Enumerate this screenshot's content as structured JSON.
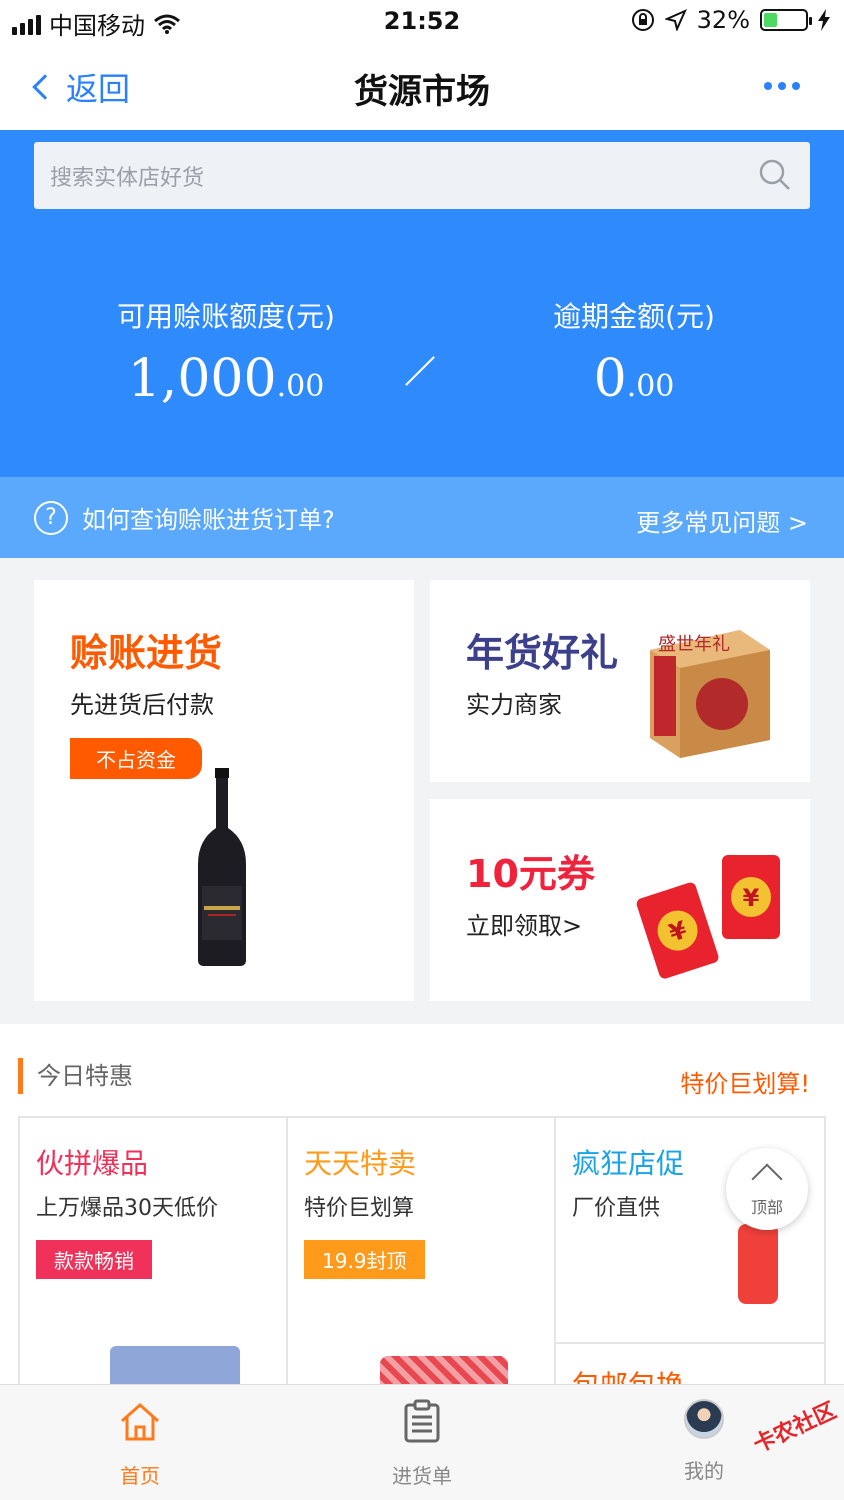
{
  "status_bar": {
    "carrier": "中国移动",
    "time": "21:52",
    "battery": "32%",
    "battery_level": 0.32
  },
  "nav": {
    "back_label": "返回",
    "title": "货源市场"
  },
  "search": {
    "placeholder": "搜索实体店好货"
  },
  "credit": {
    "available_label": "可用赊账额度(元)",
    "available_int": "1,000",
    "available_dec": ".00",
    "overdue_label": "逾期金额(元)",
    "overdue_int": "0",
    "overdue_dec": ".00"
  },
  "faq": {
    "question": "如何查询赊账进货订单?",
    "more": "更多常见问题 >"
  },
  "promos": {
    "credit_buy": {
      "title": "赊账进货",
      "subtitle": "先进货后付款",
      "badge": "不占资金"
    },
    "new_year": {
      "title": "年货好礼",
      "subtitle": "实力商家",
      "box_text": "盛世年礼"
    },
    "coupon": {
      "title": "10元券",
      "subtitle": "立即领取>"
    }
  },
  "today": {
    "heading": "今日特惠",
    "more": "特价巨划算!",
    "cells": [
      {
        "title": "伙拼爆品",
        "subtitle": "上万爆品30天低价",
        "tag": "款款畅销",
        "title_color": "#f0325a",
        "tag_color": "#f0325a"
      },
      {
        "title": "天天特卖",
        "subtitle": "特价巨划算",
        "tag": "19.9封顶",
        "title_color": "#ff9a1a",
        "tag_color": "#ff9a1a"
      },
      {
        "title": "疯狂店促",
        "subtitle": "厂价直供",
        "title_color": "#1aa3e8"
      },
      {
        "title": "包邮包换",
        "title_color": "#ff5a00"
      }
    ]
  },
  "back_to_top": "顶部",
  "tabbar": [
    {
      "label": "首页",
      "active": true
    },
    {
      "label": "进货单",
      "active": false
    },
    {
      "label": "我的",
      "active": false
    }
  ],
  "watermark": "卡农社区",
  "colors": {
    "brand_blue": "#2f8bfb",
    "accent_orange": "#ff5a00"
  }
}
